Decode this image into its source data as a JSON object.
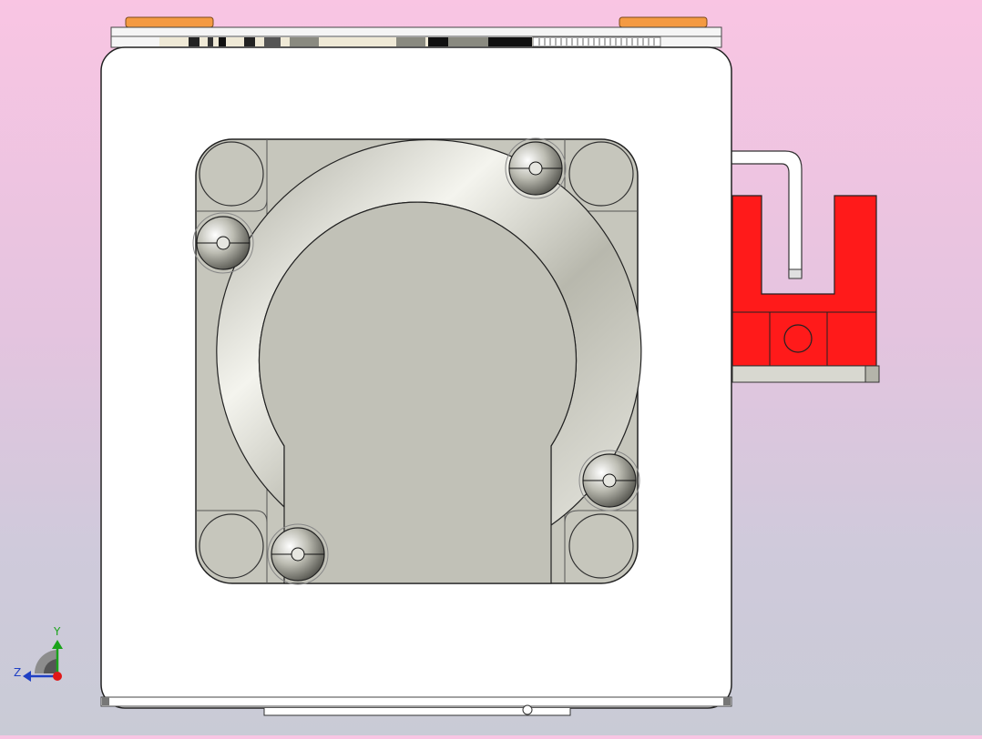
{
  "viewport": {
    "background_top": "#f9c5e3",
    "background_bottom": "#c9cbd6"
  },
  "model": {
    "body_color": "#ffffff",
    "plate_color": "#c6c6bc",
    "bracket_color": "#ff1a1a",
    "ball_count": 4
  },
  "triad": {
    "y_label": "Y",
    "z_label": "Z",
    "y_color": "#1aa31a",
    "z_color": "#1f3fc4",
    "x_color": "#e01818"
  }
}
